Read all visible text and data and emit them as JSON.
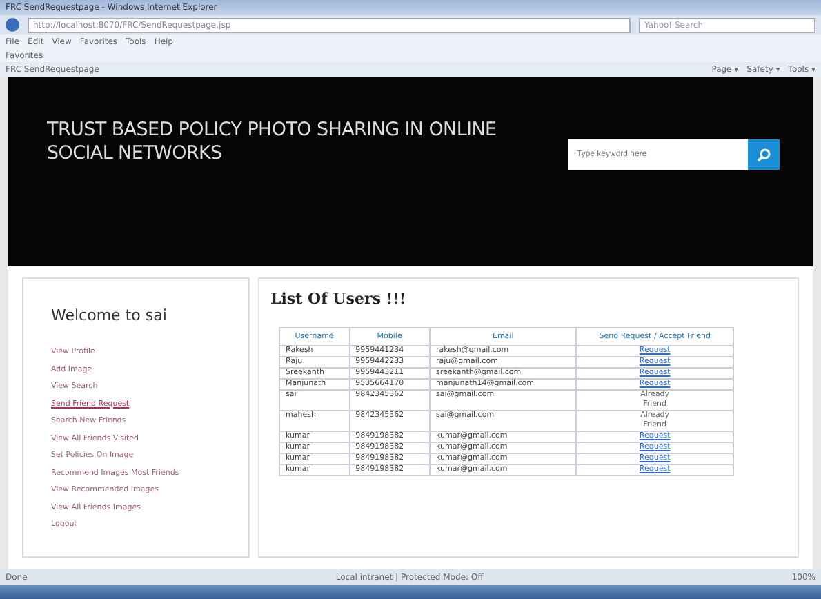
{
  "window": {
    "title": "FRC SendRequestpage - Windows Internet Explorer"
  },
  "address_bar": {
    "url": "http://localhost:8070/FRC/SendRequestpage.jsp",
    "search_placeholder": "Yahoo! Search"
  },
  "menu": [
    "File",
    "Edit",
    "View",
    "Favorites",
    "Tools",
    "Help"
  ],
  "favorites_bar": {
    "label": "Favorites"
  },
  "tab": {
    "title": "FRC SendRequestpage"
  },
  "command_bar": [
    "Page ▾",
    "Safety ▾",
    "Tools ▾"
  ],
  "header": {
    "title": "TRUST BASED POLICY PHOTO SHARING IN ONLINE SOCIAL NETWORKS",
    "search": {
      "placeholder": "Type keyword here"
    }
  },
  "sidebar": {
    "heading": "Welcome to sai",
    "items": [
      {
        "label": "View Profile",
        "selected": false
      },
      {
        "label": "Add Image",
        "selected": false
      },
      {
        "label": "View Search",
        "selected": false
      },
      {
        "label": "Send Friend Request",
        "selected": true
      },
      {
        "label": "Search New Friends",
        "selected": false
      },
      {
        "label": "View All Friends Visited",
        "selected": false
      },
      {
        "label": "Set Policies On Image",
        "selected": false
      },
      {
        "label": "Recommend Images Most Friends",
        "selected": false
      },
      {
        "label": "View Recommended Images",
        "selected": false
      },
      {
        "label": "View All Friends Images",
        "selected": false
      },
      {
        "label": "Logout",
        "selected": false
      }
    ]
  },
  "content": {
    "heading": "List Of Users !!!",
    "table": {
      "columns": [
        "Username",
        "Mobile",
        "Email",
        "Send Request / Accept Friend"
      ],
      "rows": [
        {
          "cells": [
            "Rakesh",
            "9959441234",
            "rakesh@gmail.com"
          ],
          "action": {
            "kind": "link",
            "label": "Request"
          }
        },
        {
          "cells": [
            "Raju",
            "9959442233",
            "raju@gmail.com"
          ],
          "action": {
            "kind": "link",
            "label": "Request"
          }
        },
        {
          "cells": [
            "Sreekanth",
            "9959443211",
            "sreekanth@gmail.com"
          ],
          "action": {
            "kind": "link",
            "label": "Request"
          }
        },
        {
          "cells": [
            "Manjunath",
            "9535664170",
            "manjunath14@gmail.com"
          ],
          "action": {
            "kind": "link",
            "label": "Request"
          }
        },
        {
          "cells": [
            "sai",
            "9842345362",
            "sai@gmail.com"
          ],
          "action": {
            "kind": "text",
            "label": "Already Friend"
          }
        },
        {
          "cells": [
            "mahesh",
            "9842345362",
            "sai@gmail.com"
          ],
          "action": {
            "kind": "text",
            "label": "Already Friend"
          }
        },
        {
          "cells": [
            "kumar",
            "9849198382",
            "kumar@gmail.com"
          ],
          "action": {
            "kind": "link",
            "label": "Request"
          }
        },
        {
          "cells": [
            "kumar",
            "9849198382",
            "kumar@gmail.com"
          ],
          "action": {
            "kind": "link",
            "label": "Request"
          }
        },
        {
          "cells": [
            "kumar",
            "9849198382",
            "kumar@gmail.com"
          ],
          "action": {
            "kind": "link",
            "label": "Request"
          }
        },
        {
          "cells": [
            "kumar",
            "9849198382",
            "kumar@gmail.com"
          ],
          "action": {
            "kind": "link",
            "label": "Request"
          }
        }
      ]
    }
  },
  "status_bar": {
    "left": "Done",
    "zone": "Local intranet | Protected Mode: Off",
    "zoom": "100%"
  }
}
